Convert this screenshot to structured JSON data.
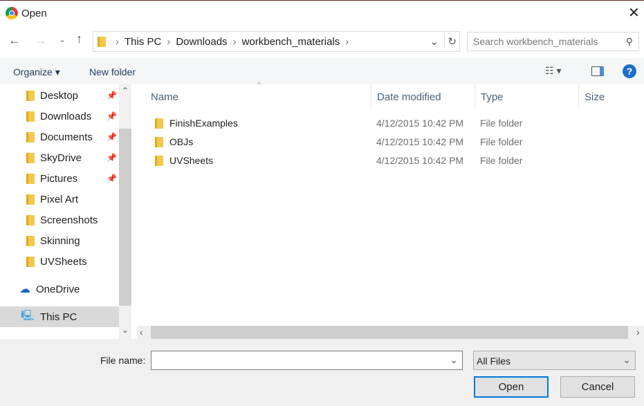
{
  "window": {
    "title": "Open"
  },
  "address": {
    "crumbs": [
      "This PC",
      "Downloads",
      "workbench_materials"
    ],
    "search_placeholder": "Search workbench_materials"
  },
  "toolbar": {
    "organize": "Organize",
    "new_folder": "New folder"
  },
  "nav": [
    {
      "label": "Desktop",
      "pinned": true
    },
    {
      "label": "Downloads",
      "pinned": true
    },
    {
      "label": "Documents",
      "pinned": true
    },
    {
      "label": "SkyDrive",
      "pinned": true
    },
    {
      "label": "Pictures",
      "pinned": true
    },
    {
      "label": "Pixel Art"
    },
    {
      "label": "Screenshots"
    },
    {
      "label": "Skinning"
    },
    {
      "label": "UVSheets"
    },
    {
      "label": "OneDrive"
    },
    {
      "label": "This PC"
    }
  ],
  "columns": {
    "name": "Name",
    "date": "Date modified",
    "type": "Type",
    "size": "Size"
  },
  "files": [
    {
      "name": "FinishExamples",
      "date": "4/12/2015 10:42 PM",
      "type": "File folder"
    },
    {
      "name": "OBJs",
      "date": "4/12/2015 10:42 PM",
      "type": "File folder"
    },
    {
      "name": "UVSheets",
      "date": "4/12/2015 10:42 PM",
      "type": "File folder"
    }
  ],
  "footer": {
    "file_name_label": "File name:",
    "file_name_value": "",
    "filter": "All Files",
    "open": "Open",
    "cancel": "Cancel"
  }
}
